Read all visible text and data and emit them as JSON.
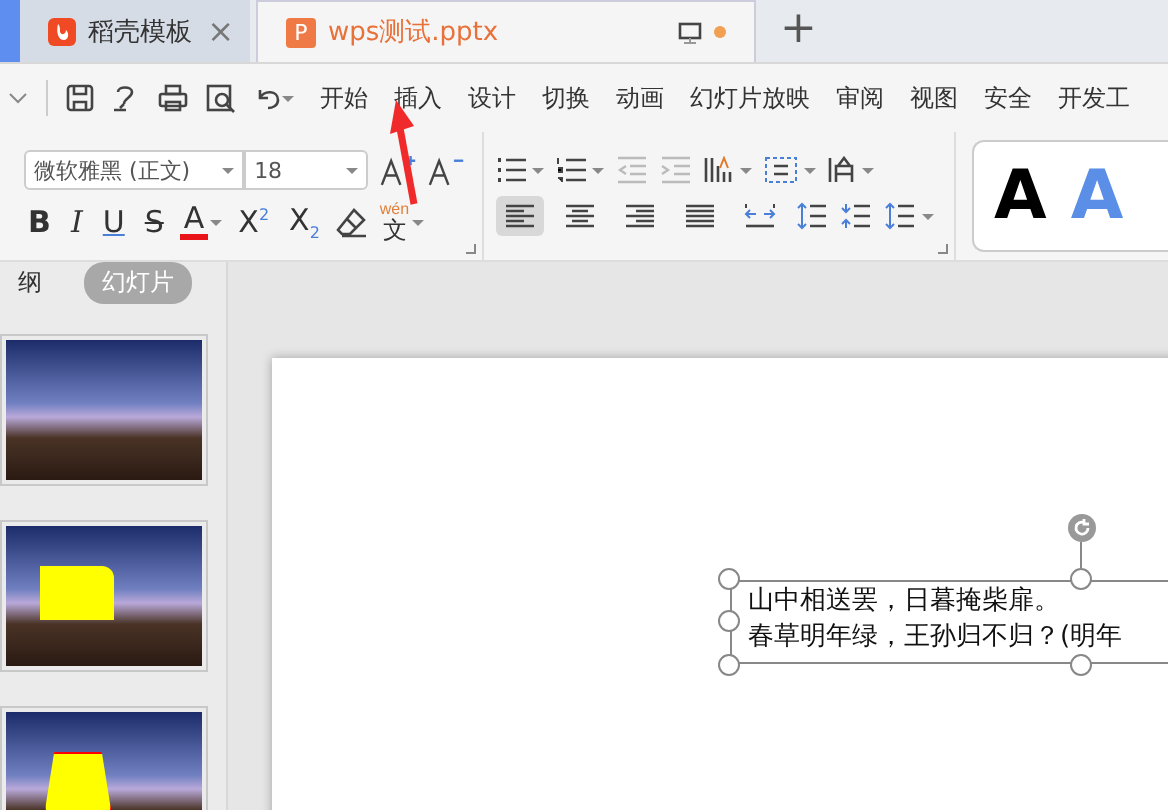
{
  "doc_tabs": [
    {
      "title": "稻壳模板",
      "selected": false,
      "kind": "docer",
      "close": "×"
    },
    {
      "title": "wps测试.pptx",
      "selected": true,
      "kind": "ppt",
      "icon_letter": "P"
    }
  ],
  "new_tab": "+",
  "menu": [
    "开始",
    "插入",
    "设计",
    "切换",
    "动画",
    "幻灯片放映",
    "审阅",
    "视图",
    "安全",
    "开发工"
  ],
  "font": {
    "name": "微软雅黑 (正文)",
    "size": "18"
  },
  "format_buttons": [
    {
      "kind": "bold",
      "label": "B"
    },
    {
      "kind": "italic",
      "label": "I"
    },
    {
      "kind": "underline",
      "label": "U"
    },
    {
      "kind": "strike",
      "label": "S"
    },
    {
      "kind": "color",
      "label": "A"
    },
    {
      "kind": "sup",
      "label": "X$^{2}$"
    },
    {
      "kind": "sub",
      "label": "X$_{2}$"
    }
  ],
  "phonetic": {
    "pinyin": "wén",
    "char": "文"
  },
  "align_buttons": [
    {
      "selected": true
    },
    {
      "selected": false
    },
    {
      "selected": false
    },
    {
      "selected": false
    },
    {
      "selected": false
    }
  ],
  "style_gallery": [
    {
      "label": "A",
      "color": "#000000"
    },
    {
      "label": "A",
      "color": "#5b8ee6"
    }
  ],
  "pane_tabs": [
    {
      "label": "纲",
      "selected": false
    },
    {
      "label": "幻灯片",
      "selected": true
    }
  ],
  "thumbnails": [
    {
      "kind": "plain"
    },
    {
      "kind": "rect"
    },
    {
      "kind": "trapezoid"
    }
  ],
  "textbox_lines": [
    "山中相送罢，日暮掩柴扉。",
    "春草明年绿，王孙归不归？(明年"
  ]
}
